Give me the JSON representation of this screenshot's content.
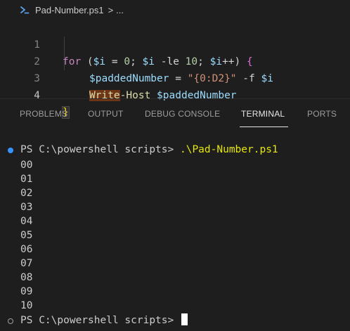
{
  "breadcrumb": {
    "file": "Pad-Number.ps1",
    "separator": ">",
    "ellipsis": "..."
  },
  "editor": {
    "lines": [
      {
        "number": "1",
        "tokens": [
          "for",
          " (",
          "$i",
          " = ",
          "0",
          "; ",
          "$i",
          " -le ",
          "10",
          "; ",
          "$i",
          "++) ",
          "{"
        ]
      },
      {
        "number": "2",
        "tokens": [
          "$paddedNumber",
          " = ",
          "\"{0:D2}\"",
          " -f ",
          "$i"
        ]
      },
      {
        "number": "3",
        "tokens": [
          "Write",
          "-Host",
          " ",
          "$paddedNumber"
        ]
      },
      {
        "number": "4",
        "tokens": [
          "}"
        ]
      }
    ]
  },
  "panel": {
    "tabs": [
      "PROBLEMS",
      "OUTPUT",
      "DEBUG CONSOLE",
      "TERMINAL",
      "PORTS"
    ],
    "active_tab": "TERMINAL"
  },
  "terminal": {
    "prompt": "PS C:\\powershell scripts> ",
    "command": ".\\Pad-Number.ps1",
    "output": [
      "00",
      "01",
      "02",
      "03",
      "04",
      "05",
      "06",
      "07",
      "08",
      "09",
      "10"
    ],
    "final_prompt": "PS C:\\powershell scripts> "
  },
  "colors": {
    "background": "#1e1e1e",
    "keyword": "#c586c0",
    "variable": "#9cdcfe",
    "number": "#b5cea8",
    "string": "#ce9178",
    "function": "#dcdcaa",
    "command": "#e5e510",
    "success_dot": "#3794ff"
  }
}
